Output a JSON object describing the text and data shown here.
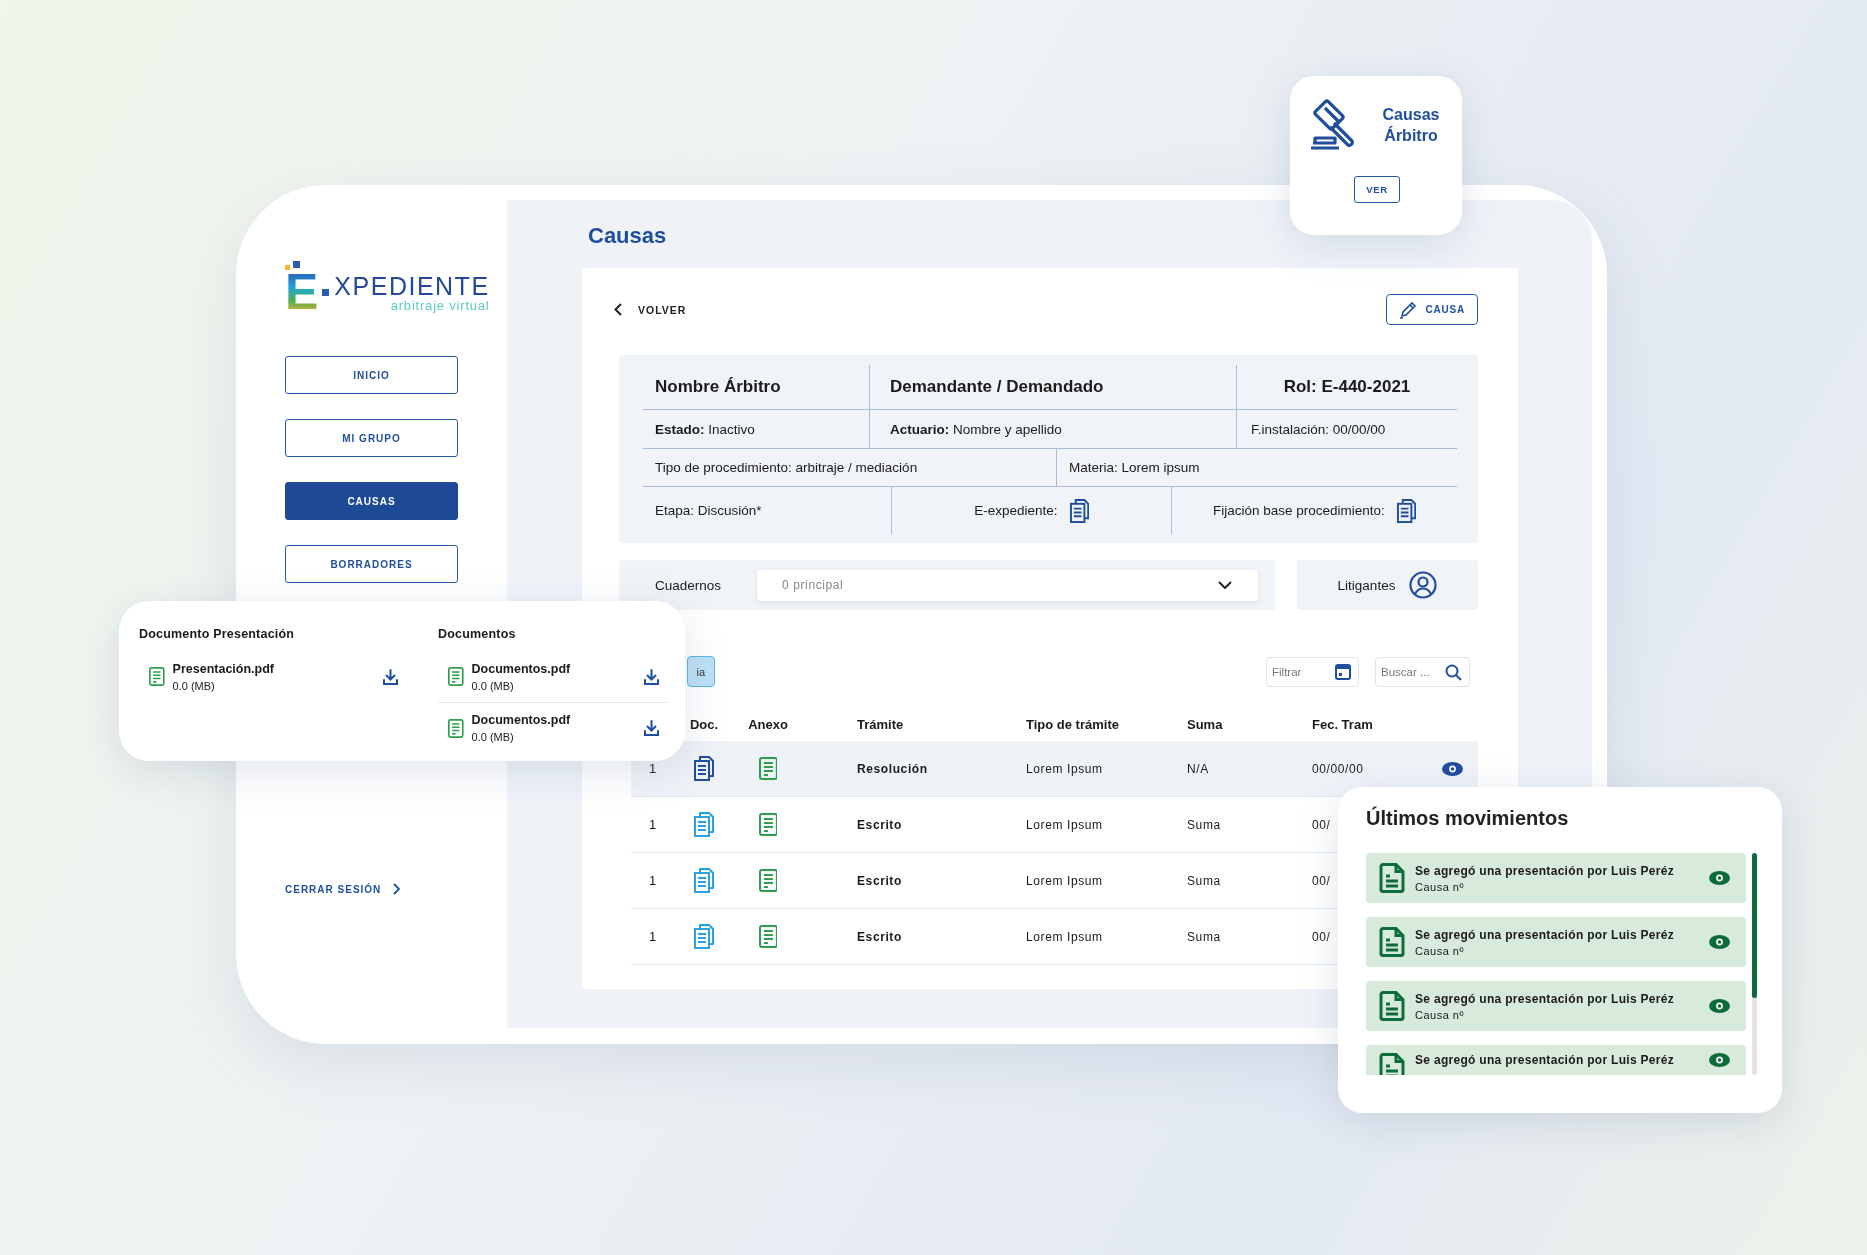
{
  "sidebar": {
    "logo": {
      "initial": "E",
      "word": "XPEDIENTE",
      "tagline": "arbitraje virtual"
    },
    "nav": [
      {
        "label": "INICIO",
        "selected": false
      },
      {
        "label": "MI GRUPO",
        "selected": false
      },
      {
        "label": "CAUSAS",
        "selected": true
      },
      {
        "label": "BORRADORES",
        "selected": false
      }
    ],
    "logout": "CERRAR SESIÓN"
  },
  "main": {
    "title": "Causas",
    "back": "VOLVER",
    "edit_button": "CAUSA",
    "info": {
      "header": [
        "Nombre Árbitro",
        "Demandante / Demandado",
        "Rol: E-440-2021"
      ],
      "rows": [
        [
          {
            "text": "**Estado:** Inactivo",
            "kind": "text"
          },
          {
            "text": "**Actuario:** Nombre y apellido",
            "kind": "text"
          },
          {
            "text": "F.instalación: 00/00/00",
            "kind": "text"
          }
        ],
        [
          {
            "text": "Tipo de procedimiento: arbitraje / mediación",
            "kind": "text"
          },
          {
            "text": "Materia: Lorem ipsum",
            "kind": "text"
          }
        ],
        [
          {
            "text": "Etapa: Discusión*",
            "kind": "text"
          },
          {
            "text": "E-expediente:",
            "kind": "document"
          },
          {
            "text": "Fijación base procedimiento:",
            "kind": "document"
          }
        ]
      ]
    },
    "cuadernos": {
      "label": "Cuadernos",
      "value": "0 principal"
    },
    "litigantes": "Litigantes",
    "tab_button": "ia",
    "filter": {
      "placeholder": "Filtrar"
    },
    "search": {
      "placeholder": "Buscar ..."
    },
    "table": {
      "columns": [
        "Doc.",
        "Anexo",
        "Trámite",
        "Tipo de trámite",
        "Suma",
        "Fec. Tram"
      ],
      "rows": [
        {
          "number": "1",
          "selected": true,
          "tramite": "Resolución",
          "tipo": "Lorem Ipsum",
          "suma": "N/A",
          "fecha": "00/00/00"
        },
        {
          "number": "1",
          "selected": false,
          "tramite": "Escrito",
          "tipo": "Lorem Ipsum",
          "suma": "Suma",
          "fecha": "00/"
        },
        {
          "number": "1",
          "selected": false,
          "tramite": "Escrito",
          "tipo": "Lorem Ipsum",
          "suma": "Suma",
          "fecha": "00/"
        },
        {
          "number": "1",
          "selected": false,
          "tramite": "Escrito",
          "tipo": "Lorem Ipsum",
          "suma": "Suma",
          "fecha": "00/"
        }
      ]
    }
  },
  "arbitro_card": {
    "title": "Causas Árbitro",
    "button": "VER"
  },
  "documents_card": {
    "sections": [
      {
        "title": "Documento Presentación",
        "files": [
          {
            "name": "Presentación.pdf",
            "size": "0.0 (MB)"
          }
        ]
      },
      {
        "title": "Documentos",
        "files": [
          {
            "name": "Documentos.pdf",
            "size": "0.0 (MB)"
          },
          {
            "name": "Documentos.pdf",
            "size": "0.0 (MB)"
          }
        ]
      }
    ]
  },
  "movements_card": {
    "title": "Últimos movimientos",
    "items": [
      {
        "text": "Se agregó una presentación por Luis Peréz",
        "subtitle": "Causa nº"
      },
      {
        "text": "Se agregó una presentación por Luis Peréz",
        "subtitle": "Causa nº"
      },
      {
        "text": "Se agregó una presentación por Luis Peréz",
        "subtitle": "Causa nº"
      },
      {
        "text": "Se agregó una presentación por Luis Peréz"
      }
    ]
  }
}
